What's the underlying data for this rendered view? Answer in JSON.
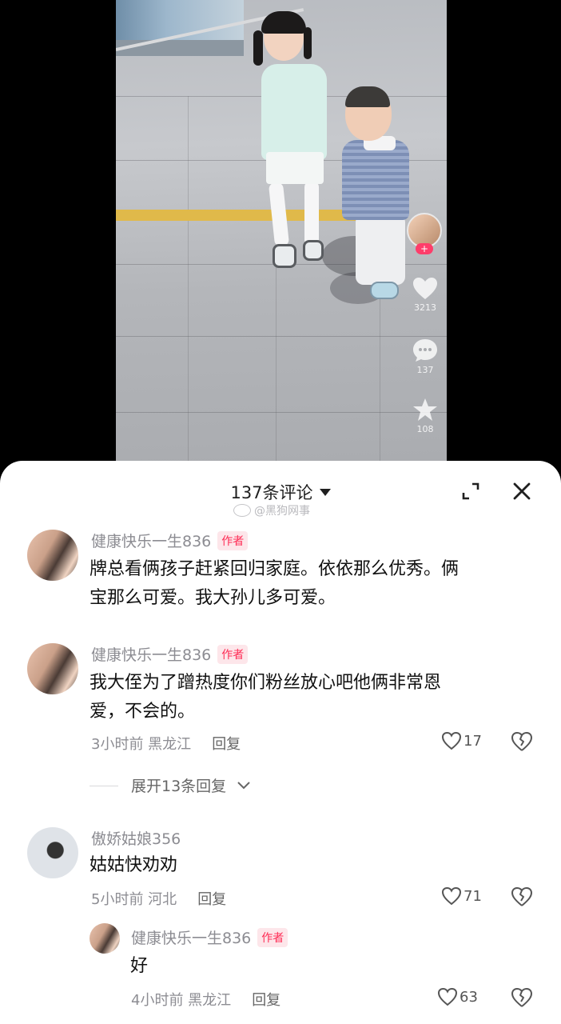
{
  "video": {
    "likes": "3213",
    "comments": "137",
    "favorites": "108",
    "follow_plus": "+"
  },
  "sheet": {
    "title": "137条评论",
    "watermark": "@黑狗网事"
  },
  "comments": [
    {
      "user": "健康快乐一生836",
      "badge": "作者",
      "text_lines": [
        "牌总看俩孩子赶紧回归家庭。依依那么优秀。俩",
        "宝那么可爱。我大孙儿多可爱。"
      ]
    },
    {
      "user": "健康快乐一生836",
      "badge": "作者",
      "text_lines": [
        "我大侄为了蹭热度你们粉丝放心吧他俩非常恩",
        "爱，不会的。"
      ],
      "time_location": "3小时前 黑龙江",
      "reply_label": "回复",
      "likes": "17",
      "expand_label": "展开13条回复"
    },
    {
      "user": "傲娇姑娘356",
      "text": "姑姑快劝劝",
      "time_location": "5小时前 河北",
      "reply_label": "回复",
      "likes": "71"
    },
    {
      "user": "健康快乐一生836",
      "badge": "作者",
      "text": "好",
      "time_location": "4小时前 黑龙江",
      "reply_label": "回复",
      "likes": "63"
    }
  ],
  "colors": {
    "author_badge_bg": "#fde6ea",
    "author_badge_text": "#fe2c55",
    "muted_text": "#8c8c92"
  }
}
